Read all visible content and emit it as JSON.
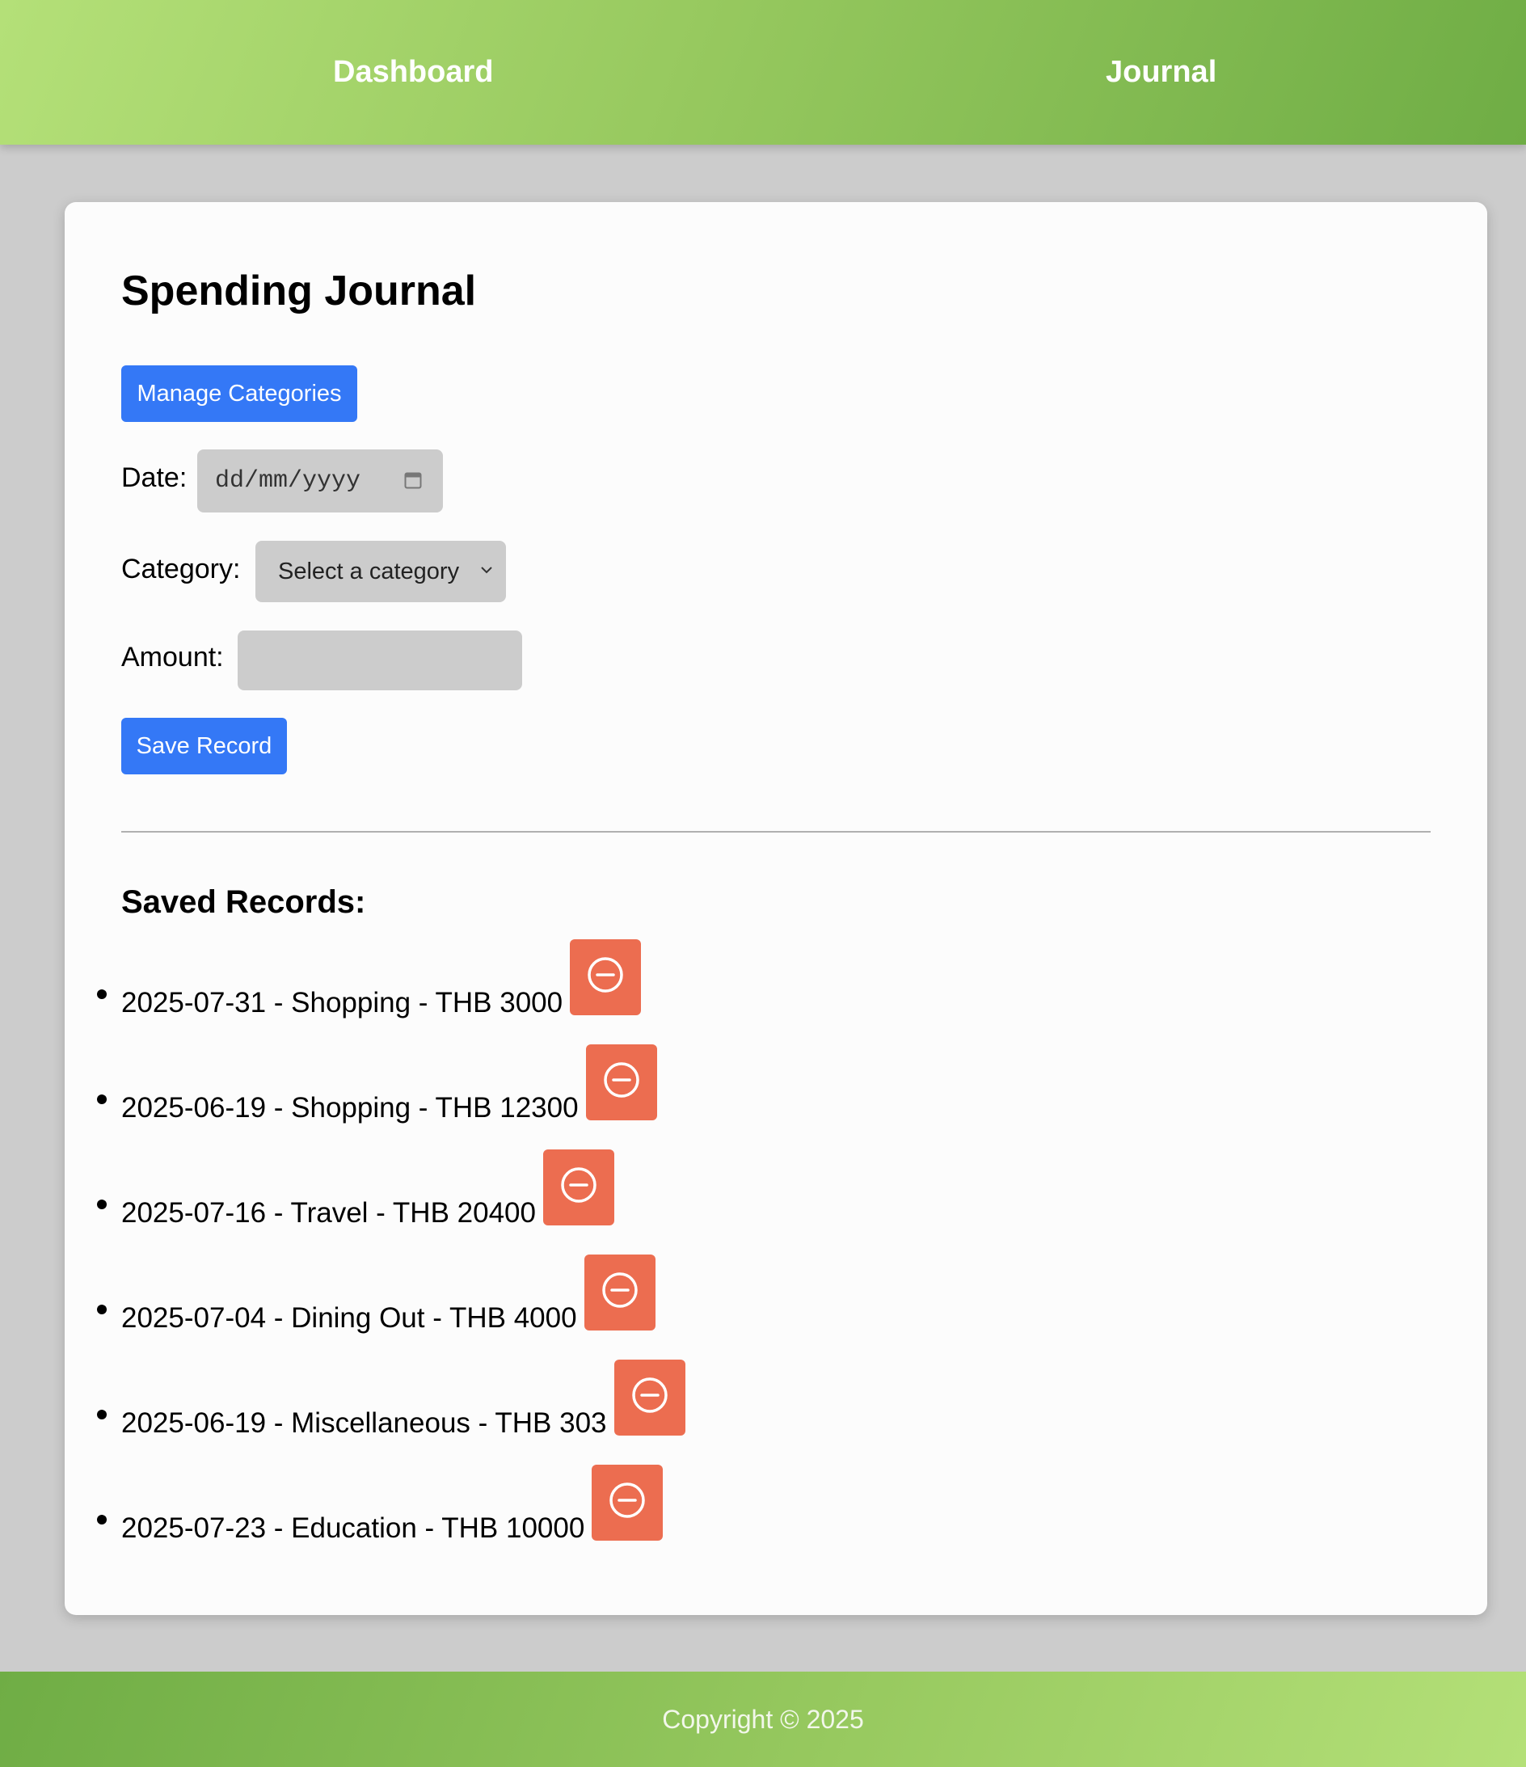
{
  "nav": {
    "links": [
      {
        "label": "Dashboard"
      },
      {
        "label": "Journal"
      }
    ]
  },
  "journal": {
    "title": "Spending Journal",
    "manage_categories_label": "Manage Categories",
    "form": {
      "date_label": "Date:",
      "date_placeholder": "dd/mm/yyyy",
      "category_label": "Category:",
      "category_selected": "Select a category",
      "amount_label": "Amount:",
      "amount_value": "",
      "save_label": "Save Record"
    },
    "saved_title": "Saved Records:",
    "records": [
      {
        "text": "2025-07-31 - Shopping - THB 3000"
      },
      {
        "text": "2025-06-19 - Shopping - THB 12300"
      },
      {
        "text": "2025-07-16 - Travel - THB 20400"
      },
      {
        "text": "2025-07-04 - Dining Out - THB 4000"
      },
      {
        "text": "2025-06-19 - Miscellaneous - THB 303"
      },
      {
        "text": "2025-07-23 - Education - THB 10000"
      }
    ]
  },
  "footer": {
    "copyright": "Copyright © 2025"
  },
  "colors": {
    "primary_button": "#3478f6",
    "delete_button": "#ec6d50",
    "header_gradient_start": "#b4e078",
    "header_gradient_end": "#6fad45",
    "page_background": "#cccccc",
    "card_background": "#fcfcfc"
  },
  "icons": {
    "delete": "minus-circle-icon",
    "date": "calendar-icon",
    "select": "chevron-down-icon"
  }
}
